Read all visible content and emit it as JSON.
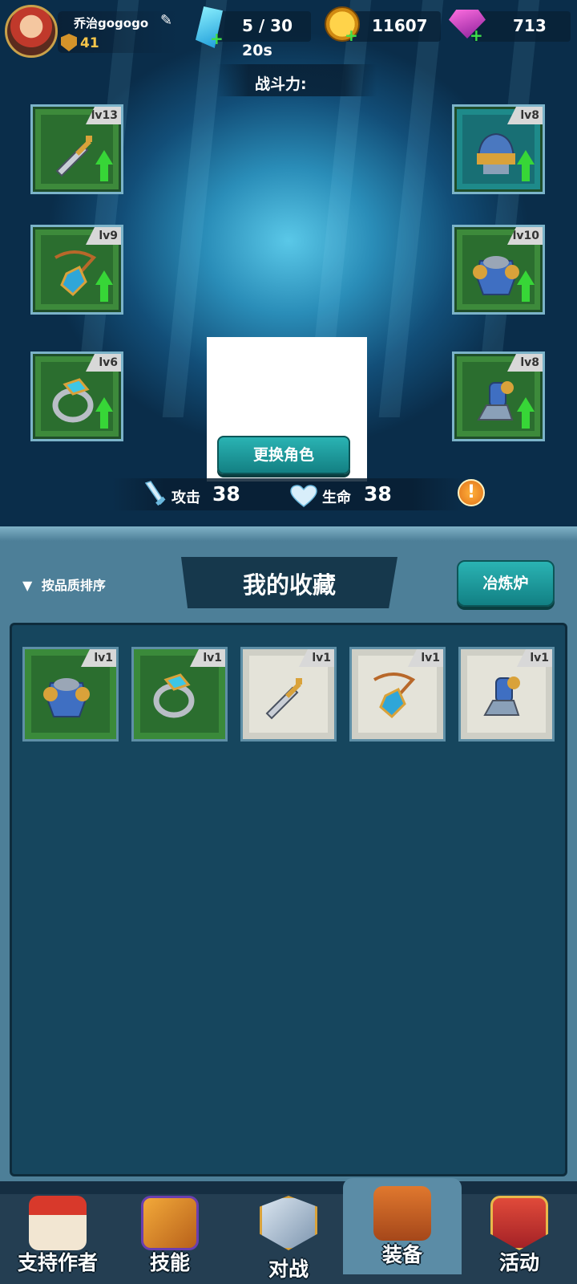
{
  "player": {
    "name": "乔治gogogo",
    "level": "41"
  },
  "resources": {
    "energy": "5 / 30",
    "energy_timer": "20s",
    "coins": "11607",
    "gems": "713"
  },
  "power": {
    "label": "战斗力:"
  },
  "equipment": {
    "left": [
      {
        "level": "lv13",
        "item": "sword-icon",
        "upgradable": true
      },
      {
        "level": "lv9",
        "item": "amulet-icon",
        "upgradable": true
      },
      {
        "level": "lv6",
        "item": "ring-icon",
        "upgradable": true
      }
    ],
    "right": [
      {
        "level": "lv8",
        "item": "helmet-icon",
        "upgradable": true
      },
      {
        "level": "lv10",
        "item": "armor-icon",
        "upgradable": true
      },
      {
        "level": "lv8",
        "item": "boots-icon",
        "upgradable": true
      }
    ]
  },
  "change_role_label": "更换角色",
  "stats": {
    "attack_label": "攻击",
    "attack_value": "38",
    "hp_label": "生命",
    "hp_value": "38"
  },
  "collection": {
    "sort_label": "按品质排序",
    "title": "我的收藏",
    "smelt_label": "冶炼炉",
    "items": [
      {
        "level": "lv1",
        "item": "armor-icon",
        "rarity": "green"
      },
      {
        "level": "lv1",
        "item": "ring-icon",
        "rarity": "green"
      },
      {
        "level": "lv1",
        "item": "sword-icon",
        "rarity": "grey"
      },
      {
        "level": "lv1",
        "item": "amulet-icon",
        "rarity": "grey"
      },
      {
        "level": "lv1",
        "item": "boots-icon",
        "rarity": "grey"
      }
    ]
  },
  "nav": [
    {
      "label": "支持作者",
      "icon": "shop-icon"
    },
    {
      "label": "技能",
      "icon": "skill-book-icon"
    },
    {
      "label": "对战",
      "icon": "crossed-swords-icon"
    },
    {
      "label": "装备",
      "icon": "backpack-icon",
      "active": true
    },
    {
      "label": "活动",
      "icon": "star-shield-icon"
    }
  ],
  "colors": {
    "accent": "#1a9fa0",
    "upgrade": "#37d637",
    "rare": "#3a8a3a",
    "common": "#cfcfc6"
  }
}
